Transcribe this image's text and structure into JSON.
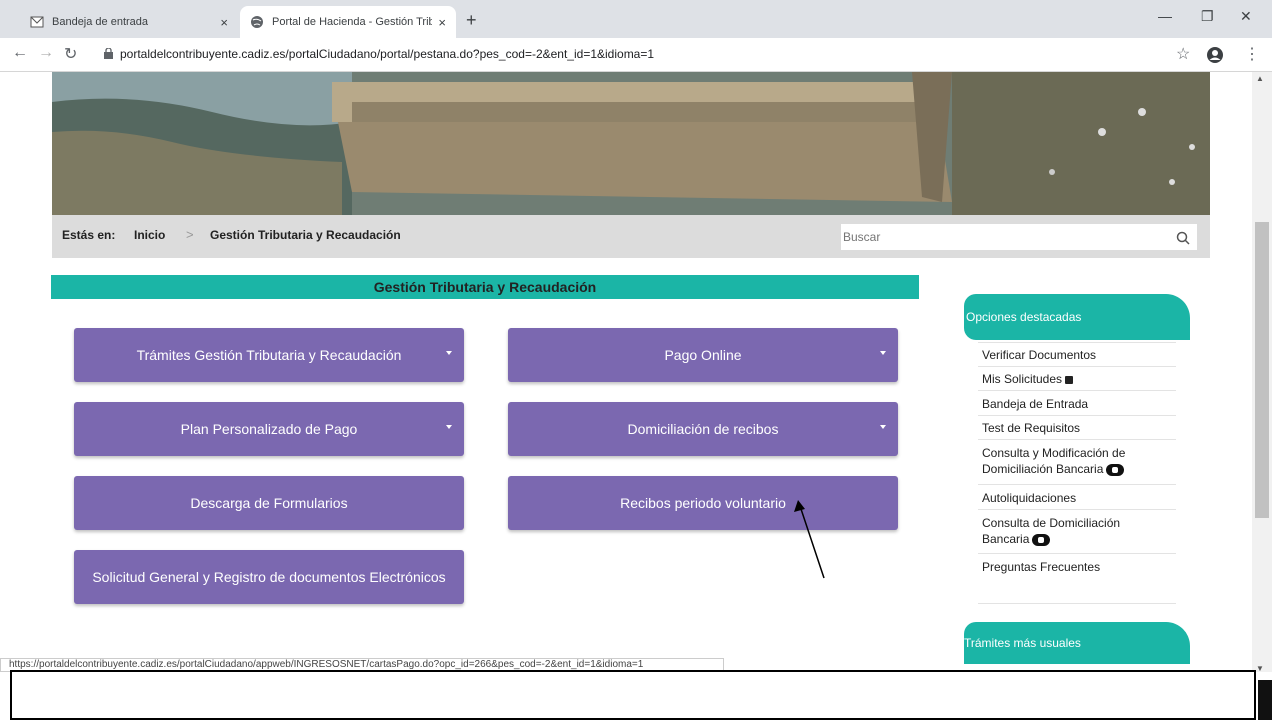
{
  "browser": {
    "tabs": [
      {
        "title": "Bandeja de entrada",
        "active": false,
        "icon": "mail-icon"
      },
      {
        "title": "Portal de Hacienda - Gestión Trib",
        "active": true,
        "icon": "globe-icon"
      }
    ],
    "close_glyph": "×",
    "new_tab_glyph": "+",
    "url": "portaldelcontribuyente.cadiz.es/portalCiudadano/portal/pestana.do?pes_cod=-2&ent_id=1&idioma=1",
    "status_url": "https://portaldelcontribuyente.cadiz.es/portalCiudadano/appweb/INGRESOSNET/cartasPago.do?opc_id=266&pes_cod=-2&ent_id=1&idioma=1"
  },
  "breadcrumb": {
    "prefix": "Estás en:",
    "home": "Inicio",
    "separator": ">",
    "current": "Gestión Tributaria y Recaudación"
  },
  "search": {
    "placeholder": "Buscar"
  },
  "section": {
    "title": "Gestión Tributaria y Recaudación"
  },
  "buttons": [
    {
      "label": "Trámites Gestión Tributaria y Recaudación",
      "dropdown": true
    },
    {
      "label": "Pago Online",
      "dropdown": true
    },
    {
      "label": "Plan Personalizado de Pago",
      "dropdown": true
    },
    {
      "label": "Domiciliación de recibos",
      "dropdown": true
    },
    {
      "label": "Descarga de Formularios",
      "dropdown": false
    },
    {
      "label": "Recibos periodo voluntario",
      "dropdown": false
    },
    {
      "label": "Solicitud General y Registro de documentos Electrónicos",
      "dropdown": false
    }
  ],
  "sidebar": {
    "heading": "Opciones destacadas",
    "items": [
      {
        "label": "Verificar Documentos"
      },
      {
        "label": "Mis Solicitudes"
      },
      {
        "label": "Bandeja de Entrada"
      },
      {
        "label": "Test de Requisitos"
      },
      {
        "label": "Consulta y Modificación de",
        "label2": "Domiciliación Bancaria"
      },
      {
        "label": "Autoliquidaciones"
      },
      {
        "label": "Consulta de Domiciliación",
        "label2": "Bancaria"
      },
      {
        "label": "Preguntas Frecuentes"
      }
    ],
    "heading2": "Trámites más usuales"
  },
  "colors": {
    "teal": "#1bb5a6",
    "purple": "#7b68b0",
    "breadcrumb_bg": "#dcdcdc"
  }
}
